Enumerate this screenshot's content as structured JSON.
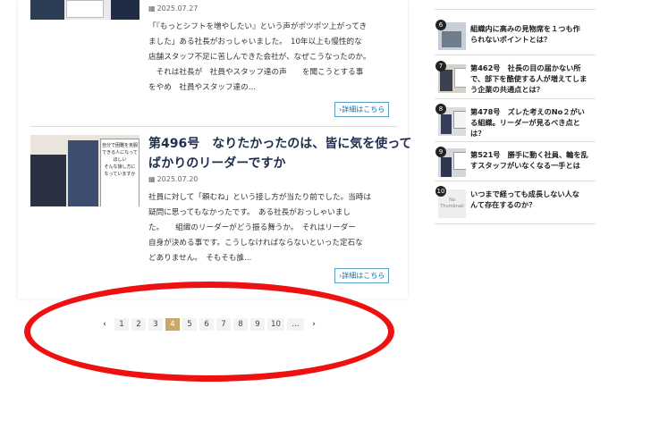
{
  "articles": [
    {
      "date": "2025.07.27",
      "excerpt": [
        "「『もっとシフトを増やしたい』という声がポツポツ上がってき",
        "ました」ある社長がおっしゃいました。　10年以上も慢性的な",
        "店舗スタッフ不足に苦しんできた会社が、なぜこうなったのか。",
        "　それは社長が　社員やスタッフ達の声　　を聞こうとする事",
        "をやめ　社員やスタッフ達の..."
      ],
      "more": "詳細はこちら"
    },
    {
      "title_lines": [
        "第496号　なりたかったのは、皆に気を使って",
        "ばかりのリーダーですか"
      ],
      "date": "2025.07.20",
      "thumb_lines": [
        "自分で困難を克服",
        "できる人になって",
        "ほしい",
        "そんな接し方に",
        "なっていますか"
      ],
      "excerpt": [
        "社員に対して「頼むね」という接し方が当たり前でした。当時は",
        "疑問に思ってもなかったです。　ある社長がおっしゃいまし",
        "た。　　組織のリーダーがどう振る舞うか。　それはリーダー",
        "自身が決める事です。こうしなければならないといった定石な",
        "どありません。　そもそも誰..."
      ],
      "more": "詳細はこちら"
    }
  ],
  "pagination": {
    "prev": "‹",
    "pages": [
      "1",
      "2",
      "3",
      "4",
      "5",
      "6",
      "7",
      "8",
      "9",
      "10",
      "..."
    ],
    "current": "4",
    "next": "›"
  },
  "sidebar": [
    {
      "rank": "6",
      "lines": [
        "組織内に高みの見物席を１つも作",
        "られないポイントとは？"
      ]
    },
    {
      "rank": "7",
      "lines": [
        "第462号　社長の目の届かない所",
        "で、部下を酷使する人が増えてしま",
        "う企業の共通点とは？"
      ]
    },
    {
      "rank": "8",
      "lines": [
        "第478号　ズレた考えのNo２がい",
        "る組織。リーダーが見るべき点と",
        "は？"
      ]
    },
    {
      "rank": "9",
      "lines": [
        "第521号　勝手に動く社員、輪を乱",
        "すスタッフがいなくなる一手とは"
      ]
    },
    {
      "rank": "10",
      "thumb_text": [
        "No",
        "Thumbnail"
      ],
      "lines": [
        "いつまで経っても成長しない人な",
        "んて存在するのか？"
      ]
    }
  ],
  "colors": {
    "title": "#1f2d4e",
    "link": "#1e6fa5",
    "current_page": "#c9a86a",
    "annotation": "#ee1111"
  }
}
